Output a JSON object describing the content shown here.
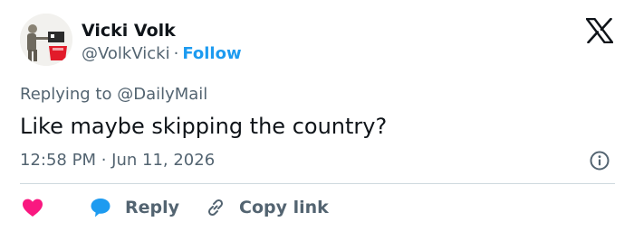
{
  "author": {
    "name": "Vicki Volk",
    "handle": "@VolkVicki",
    "separator": "·",
    "follow_label": "Follow"
  },
  "icons": {
    "brand": "x-logo-icon",
    "info": "info-icon",
    "like": "heart-icon",
    "reply": "speech-bubble-icon",
    "copy": "link-icon"
  },
  "tweet": {
    "replying_prefix": "Replying to ",
    "replying_to": "@DailyMail",
    "text": "Like maybe skipping the country?",
    "timestamp": "12:58 PM · Jun 11, 2026"
  },
  "actions": {
    "reply_label": "Reply",
    "copy_link_label": "Copy link"
  },
  "colors": {
    "accent": "#1d9bf0",
    "like": "#f91880",
    "secondary_text": "#536471",
    "primary_text": "#0f1419"
  }
}
